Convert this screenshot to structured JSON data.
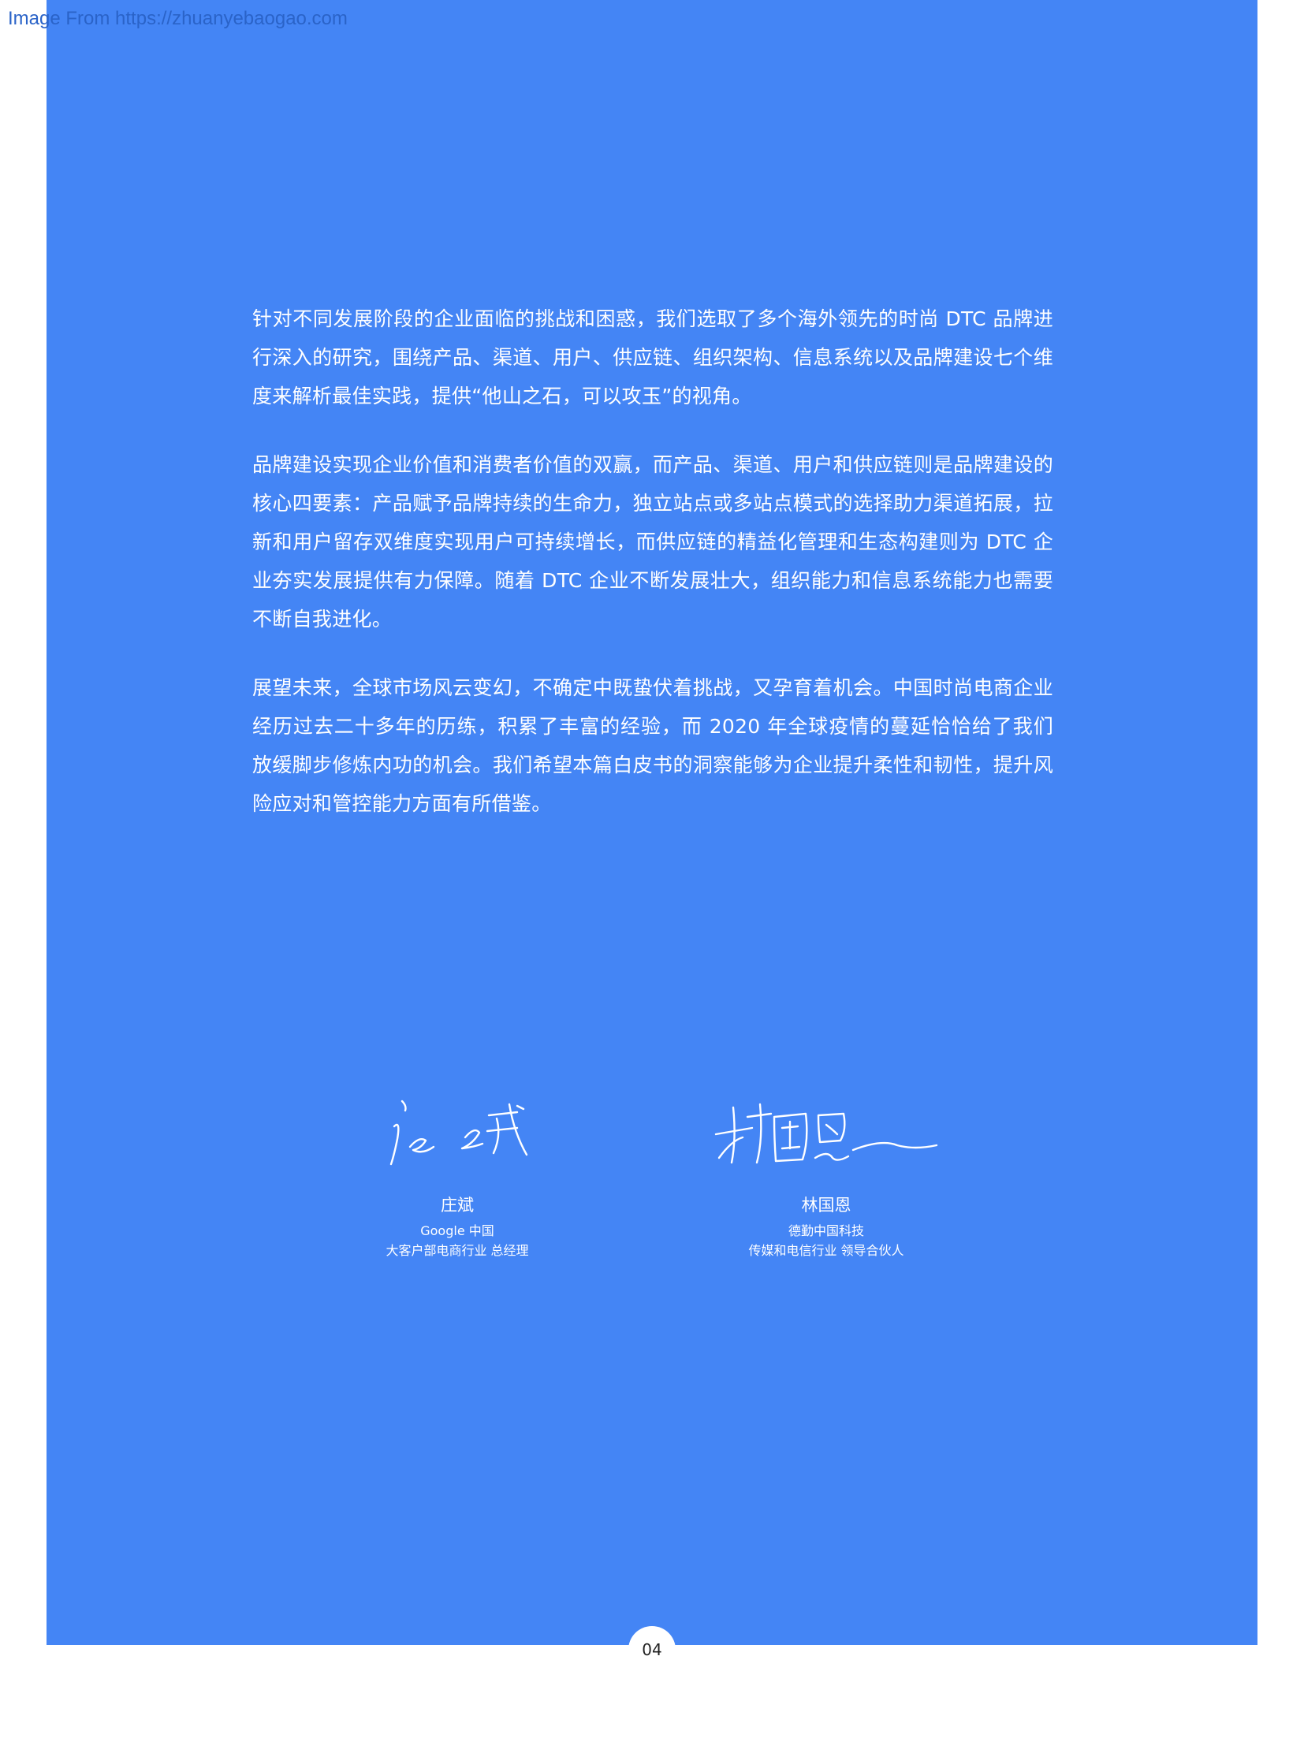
{
  "watermark": "Image From https://zhuanyebaogao.com",
  "paragraphs": [
    "针对不同发展阶段的企业面临的挑战和困惑，我们选取了多个海外领先的时尚 DTC 品牌进行深入的研究，围绕产品、渠道、用户、供应链、组织架构、信息系统以及品牌建设七个维度来解析最佳实践，提供“他山之石，可以攻玉”的视角。",
    "品牌建设实现企业价值和消费者价值的双赢，而产品、渠道、用户和供应链则是品牌建设的核心四要素：产品赋予品牌持续的生命力，独立站点或多站点模式的选择助力渠道拓展，拉新和用户留存双维度实现用户可持续增长，而供应链的精益化管理和生态构建则为 DTC 企业夯实发展提供有力保障。随着 DTC 企业不断发展壮大，组织能力和信息系统能力也需要不断自我进化。",
    "展望未来，全球市场风云变幻，不确定中既蛰伏着挑战，又孕育着机会。中国时尚电商企业经历过去二十多年的历练，积累了丰富的经验，而  2020  年全球疫情的蔓延恰恰给了我们放缓脚步修炼内功的机会。我们希望本篇白皮书的洞察能够为企业提升柔性和韧性，提升风险应对和管控能力方面有所借鉴。"
  ],
  "signatories": [
    {
      "signature_text": "庄斌",
      "name": "庄斌",
      "organization": "Google 中国",
      "role": "大客户部电商行业  总经理"
    },
    {
      "signature_text": "林国恩",
      "name": "林国恩",
      "organization": "德勤中国科技",
      "role": "传媒和电信行业  领导合伙人"
    }
  ],
  "page_number": "04"
}
